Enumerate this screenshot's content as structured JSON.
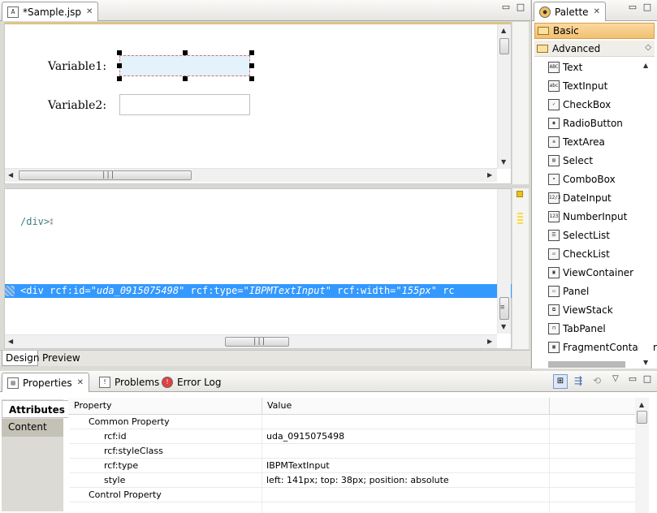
{
  "editor": {
    "tab_title": "*Sample.jsp",
    "design": {
      "variable1_label": "Variable1:",
      "variable2_label": "Variable2:"
    },
    "source": {
      "line1": "/div>",
      "line2_tag": "<div rcf:id=",
      "line2_id": "\"uda_0915075498\"",
      "line2_type_attr": " rcf:type=",
      "line2_type": "\"IBPMTextInput\"",
      "line2_width_attr": " rcf:width=",
      "line2_width": "\"155px\"",
      "line2_tail": " rc"
    },
    "bottom_tabs": [
      "Design",
      "Preview"
    ]
  },
  "palette": {
    "title": "Palette",
    "drawers": [
      {
        "label": "Basic",
        "open": true
      },
      {
        "label": "Advanced",
        "open": false
      }
    ],
    "items": [
      {
        "label": "Text",
        "icon": "ABC"
      },
      {
        "label": "TextInput",
        "icon": "abc"
      },
      {
        "label": "CheckBox",
        "icon": "✓"
      },
      {
        "label": "RadioButton",
        "icon": "◉"
      },
      {
        "label": "TextArea",
        "icon": "≡"
      },
      {
        "label": "Select",
        "icon": "▤"
      },
      {
        "label": "ComboBox",
        "icon": "▾"
      },
      {
        "label": "DateInput",
        "icon": "12/3"
      },
      {
        "label": "NumberInput",
        "icon": "123"
      },
      {
        "label": "SelectList",
        "icon": "☰"
      },
      {
        "label": "CheckList",
        "icon": "☑"
      },
      {
        "label": "ViewContainer",
        "icon": "▣"
      },
      {
        "label": "Panel",
        "icon": "▭"
      },
      {
        "label": "ViewStack",
        "icon": "⧉"
      },
      {
        "label": "TabPanel",
        "icon": "⊓"
      },
      {
        "label": "FragmentContainer",
        "icon": "▦"
      }
    ]
  },
  "properties": {
    "tabs": [
      {
        "label": "Properties",
        "icon": "properties-icon"
      },
      {
        "label": "Problems",
        "icon": "problems-icon"
      },
      {
        "label": "Error Log",
        "icon": "error-log-icon"
      }
    ],
    "side_tabs": [
      "Attributes",
      "Content"
    ],
    "columns": [
      "Property",
      "Value"
    ],
    "rows": [
      {
        "property": "Common Property",
        "value": "",
        "indent": 1
      },
      {
        "property": "rcf:id",
        "value": "uda_0915075498",
        "indent": 2
      },
      {
        "property": "rcf:styleClass",
        "value": "",
        "indent": 2
      },
      {
        "property": "rcf:type",
        "value": "IBPMTextInput",
        "indent": 2
      },
      {
        "property": "style",
        "value": "left: 141px; top: 38px; position: absolute",
        "indent": 2
      },
      {
        "property": "Control Property",
        "value": "",
        "indent": 1
      }
    ]
  },
  "colors": {
    "selection": "#3399ff",
    "code_tag": "#3f7f7f",
    "code_attr": "#7f007f",
    "code_value": "#2a00ff"
  }
}
